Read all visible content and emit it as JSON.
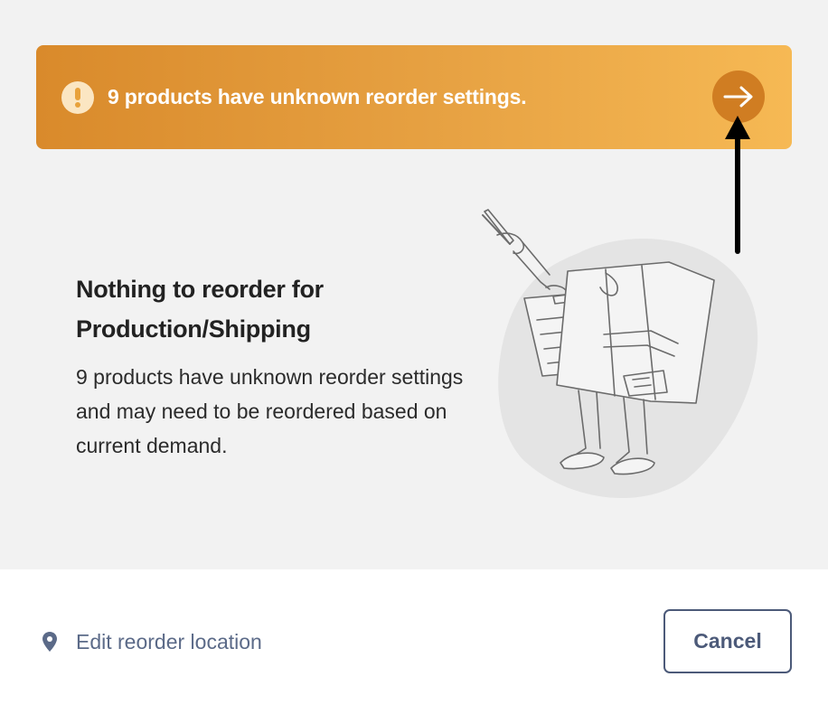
{
  "banner": {
    "message": "9 products have unknown reorder settings.",
    "warning_icon": "exclamation-circle-icon",
    "action_icon": "arrow-right-icon",
    "gradient_colors": [
      "#d98a2b",
      "#f6b954"
    ],
    "action_button_color": "#d07d22"
  },
  "empty_state": {
    "title": "Nothing to reorder for Production/Shipping",
    "description": "9 products have unknown reorder settings and may need to be reordered based on current demand.",
    "illustration": "person-with-clipboard-illustration"
  },
  "footer": {
    "location_icon": "map-pin-icon",
    "edit_location_label": "Edit reorder location",
    "cancel_label": "Cancel",
    "accent_color": "#4c5a79"
  }
}
